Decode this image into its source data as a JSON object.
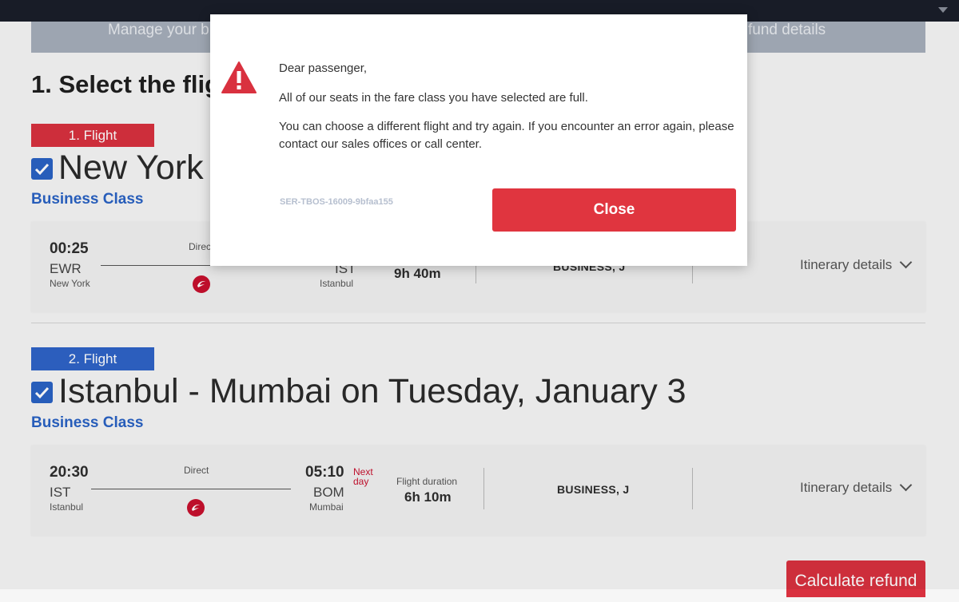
{
  "header": {
    "manage_left": "Manage your b",
    "manage_right": "fund details"
  },
  "section_title": "1. Select the fligh",
  "flights": [
    {
      "tag": "1. Flight",
      "route": "New York -",
      "cabin": "Business Class",
      "departure": {
        "time": "00:25",
        "code": "EWR",
        "city": "New York"
      },
      "stops": "Direc",
      "arrival": {
        "code": "IST",
        "city": "Istanbul"
      },
      "duration": "9h 40m",
      "fare": "BUSINESS, J",
      "itinerary": "Itinerary details"
    },
    {
      "tag": "2. Flight",
      "route": "Istanbul - Mumbai on Tuesday, January 3",
      "cabin": "Business Class",
      "departure": {
        "time": "20:30",
        "code": "IST",
        "city": "Istanbul"
      },
      "stops": "Direct",
      "arrival": {
        "time": "05:10",
        "code": "BOM",
        "city": "Mumbai",
        "next_day_1": "Next",
        "next_day_2": "day"
      },
      "duration_label": "Flight duration",
      "duration": "6h 10m",
      "fare": "BUSINESS, J",
      "itinerary": "Itinerary details"
    }
  ],
  "calculate_button": "Calculate refund",
  "modal": {
    "greeting": "Dear passenger,",
    "line1": "All of our seats in the fare class you have selected are full.",
    "line2": "You can choose a different flight and try again. If you encounter an error again, please contact our sales offices or call center.",
    "error_code": "SER-TBOS-16009-9bfaa155",
    "close_label": "Close"
  },
  "colors": {
    "accent_red": "#d9313f",
    "accent_blue": "#2a63c4",
    "topbar": "#1a1e2a"
  },
  "icons": [
    "warning-icon",
    "check-icon",
    "airline-logo-icon",
    "chevron-down-icon"
  ]
}
